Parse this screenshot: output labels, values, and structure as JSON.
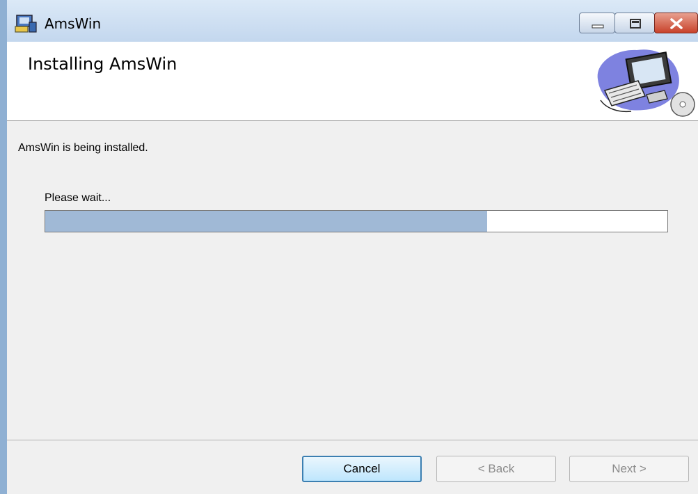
{
  "window": {
    "title": "AmsWin",
    "app_icon": "installer-icon"
  },
  "caption_buttons": {
    "minimize_icon": "minimize-icon",
    "maximize_icon": "maximize-icon",
    "close_icon": "close-icon",
    "close_color": "#c8422b"
  },
  "header": {
    "title": "Installing AmsWin",
    "art": "computer-cd-icon"
  },
  "body": {
    "status": "AmsWin is being installed.",
    "wait_label": "Please wait...",
    "progress_fraction": 0.71,
    "progress_color": "#a0b9d6"
  },
  "footer": {
    "cancel_label": "Cancel",
    "back_label": "< Back",
    "next_label": "Next >"
  }
}
